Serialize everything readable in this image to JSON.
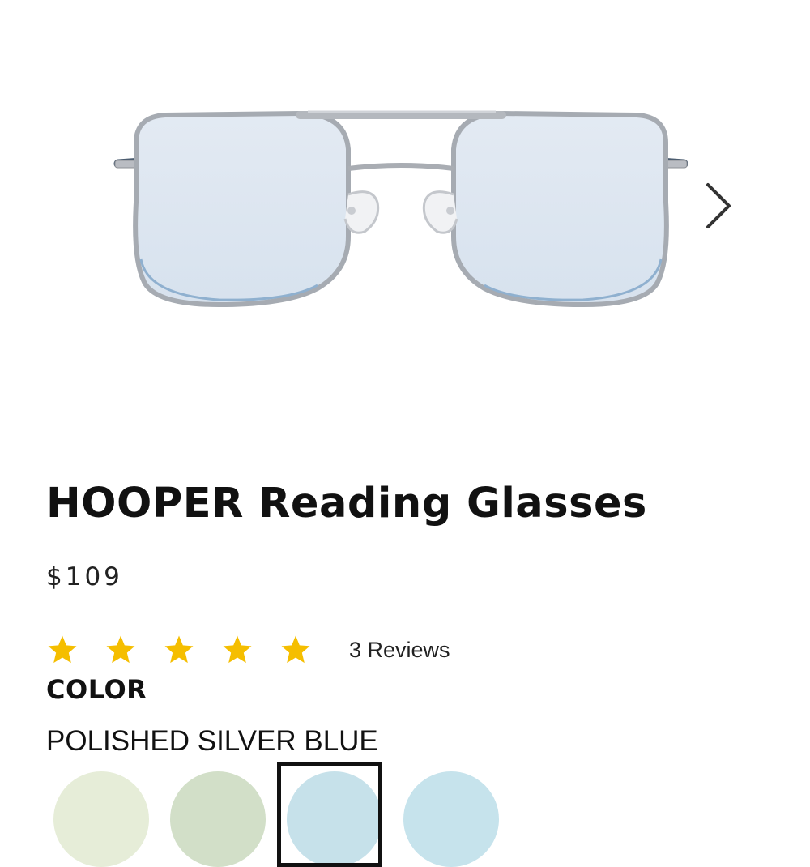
{
  "product": {
    "title": "HOOPER Reading Glasses",
    "price": "$109",
    "rating": 5,
    "rating_max": 5,
    "reviews_label": "3 Reviews",
    "star_color": "#F5BE00"
  },
  "gallery": {
    "image_icon": "aviator-glasses-image",
    "next_icon": "chevron-right-icon"
  },
  "color": {
    "label": "COLOR",
    "selected": "POLISHED SILVER BLUE",
    "selected_index": 2,
    "swatches": [
      {
        "color": "#E6EDD8"
      },
      {
        "color": "#D2DFC8"
      },
      {
        "color": "#C6E1EA"
      },
      {
        "color": "#C6E3EC"
      }
    ]
  }
}
